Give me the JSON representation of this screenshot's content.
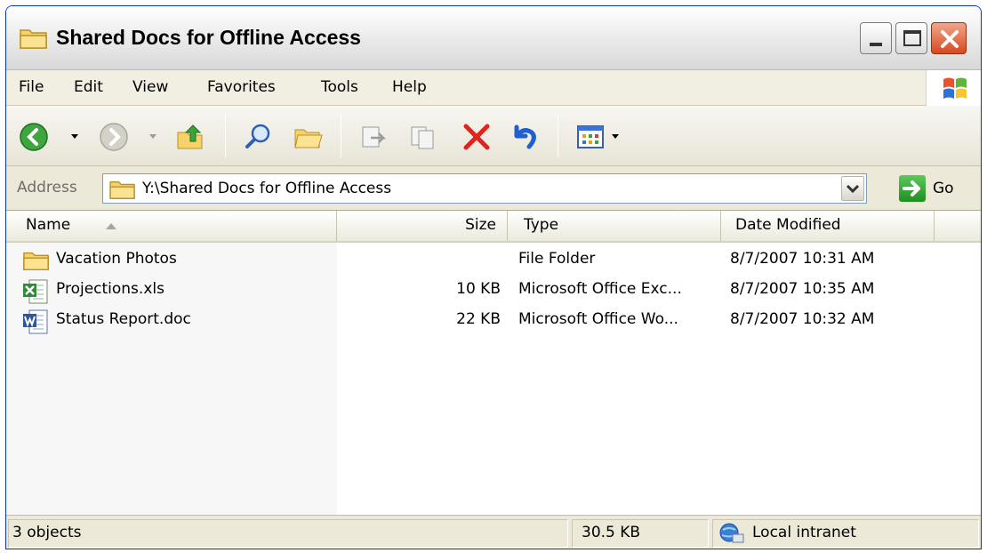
{
  "window": {
    "title": "Shared Docs for Offline Access"
  },
  "menu": {
    "items": [
      "File",
      "Edit",
      "View",
      "Favorites",
      "Tools",
      "Help"
    ]
  },
  "address": {
    "label": "Address",
    "value": "Y:\\Shared Docs for Offline Access",
    "go_label": "Go"
  },
  "columns": {
    "name": "Name",
    "size": "Size",
    "type": "Type",
    "date": "Date Modified"
  },
  "files": [
    {
      "name": "Vacation Photos",
      "size": "",
      "type": "File Folder",
      "date": "8/7/2007 10:31 AM",
      "icon": "folder-icon"
    },
    {
      "name": "Projections.xls",
      "size": "10 KB",
      "type": "Microsoft Office Exc...",
      "date": "8/7/2007 10:35 AM",
      "icon": "excel-file-icon"
    },
    {
      "name": "Status Report.doc",
      "size": "22 KB",
      "type": "Microsoft Office Wo...",
      "date": "8/7/2007 10:32 AM",
      "icon": "word-file-icon"
    }
  ],
  "status": {
    "objects": "3 objects",
    "size": "30.5 KB",
    "zone": "Local intranet"
  },
  "colors": {
    "title_border": "#0831d9",
    "chrome": "#ece9d8",
    "close_red": "#d6491f",
    "go_green": "#1f8f1f"
  }
}
